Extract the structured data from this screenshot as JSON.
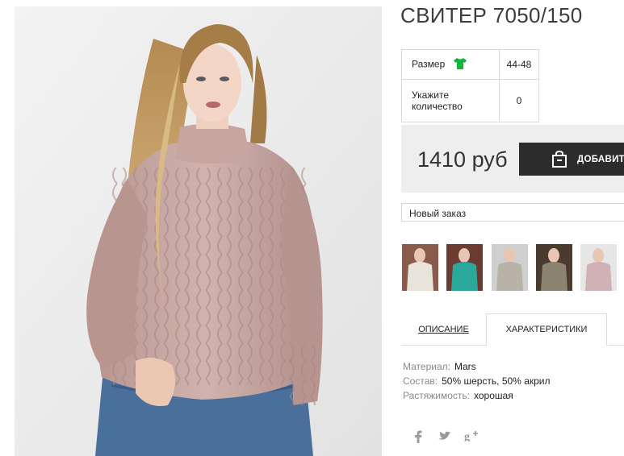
{
  "product": {
    "title": "СВИТЕР 7050/150",
    "price": "1410 руб",
    "add_button_label": "ДОБАВИТЬ"
  },
  "options": {
    "size_label": "Размер",
    "size_value": "44-48",
    "qty_label": "Укажите количество",
    "qty_value": "0"
  },
  "order": {
    "selected": "Новый заказ"
  },
  "thumbnails": [
    {
      "name": "thumb-white-sweater",
      "color": "#e9e4da"
    },
    {
      "name": "thumb-teal-sweater",
      "color": "#2aa99a"
    },
    {
      "name": "thumb-grey-sweater",
      "color": "#b7b3a8"
    },
    {
      "name": "thumb-olive-sweater",
      "color": "#8b8470"
    },
    {
      "name": "thumb-pink-sweater",
      "color": "#cfb1b6"
    }
  ],
  "tabs": {
    "description": "ОПИСАНИЕ",
    "characteristics": "ХАРАКТЕРИСТИКИ"
  },
  "specs": [
    {
      "key": "Материал:",
      "value": "Mars"
    },
    {
      "key": "Состав:",
      "value": "50% шерсть, 50% акрил"
    },
    {
      "key": "Растяжимость:",
      "value": "хорошая"
    }
  ],
  "social": [
    "facebook-icon",
    "twitter-icon",
    "google-plus-icon"
  ],
  "colors": {
    "size_icon": "#17b33c",
    "price_panel": "#eeeeee",
    "add_button": "#2c2c2c",
    "sweater": "#c9aaa6"
  }
}
